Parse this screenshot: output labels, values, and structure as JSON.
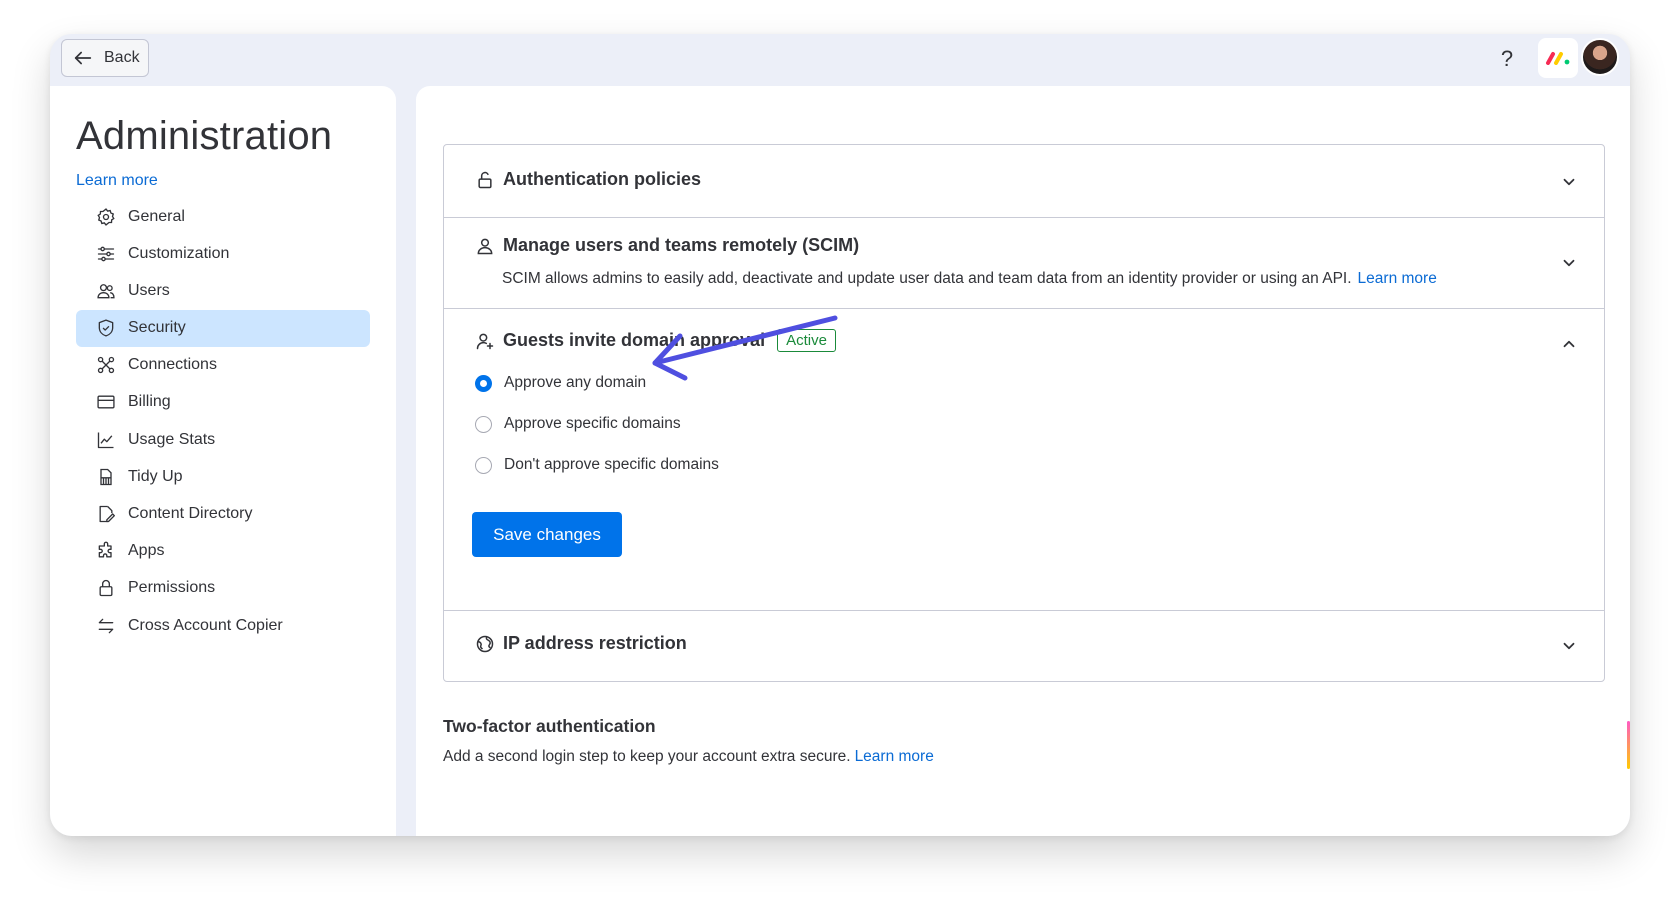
{
  "topbar": {
    "back_label": "Back",
    "help_icon": "question-icon",
    "help_label": "?",
    "brand_icon": "monday-logo-icon",
    "avatar_icon": "user-avatar"
  },
  "sidebar": {
    "title": "Administration",
    "learn_more": "Learn more",
    "items": [
      {
        "label": "General",
        "icon": "gear-icon"
      },
      {
        "label": "Customization",
        "icon": "sliders-icon"
      },
      {
        "label": "Users",
        "icon": "users-icon"
      },
      {
        "label": "Security",
        "icon": "shield-icon",
        "active": true
      },
      {
        "label": "Connections",
        "icon": "connections-icon"
      },
      {
        "label": "Billing",
        "icon": "credit-card-icon"
      },
      {
        "label": "Usage Stats",
        "icon": "chart-icon"
      },
      {
        "label": "Tidy Up",
        "icon": "broom-icon"
      },
      {
        "label": "Content Directory",
        "icon": "document-edit-icon"
      },
      {
        "label": "Apps",
        "icon": "puzzle-icon"
      },
      {
        "label": "Permissions",
        "icon": "lock-icon"
      },
      {
        "label": "Cross Account Copier",
        "icon": "transfer-icon"
      }
    ]
  },
  "main": {
    "sections": {
      "auth": {
        "title": "Authentication policies",
        "icon": "unlock-icon"
      },
      "scim": {
        "title": "Manage users and teams remotely (SCIM)",
        "icon": "user-icon",
        "description": "SCIM allows admins to easily add, deactivate and update user data and team data from an identity provider or using an API.",
        "learn_more": "Learn more"
      },
      "guests": {
        "title": "Guests invite domain approval",
        "icon": "user-plus-icon",
        "badge": "Active",
        "options": [
          {
            "label": "Approve any domain",
            "checked": true
          },
          {
            "label": "Approve specific domains",
            "checked": false
          },
          {
            "label": "Don't approve specific domains",
            "checked": false
          }
        ],
        "save_label": "Save changes"
      },
      "ip": {
        "title": "IP address restriction",
        "icon": "globe-icon"
      }
    },
    "two_factor": {
      "title": "Two-factor authentication",
      "description": "Add a second login step to keep your account extra secure.",
      "learn_more": "Learn more"
    }
  },
  "colors": {
    "accent": "#0073ea",
    "link": "#0b6bd4",
    "active_nav": "#cce5ff",
    "badge_green": "#1a8a3a",
    "annotation_arrow": "#4f4fe0"
  }
}
